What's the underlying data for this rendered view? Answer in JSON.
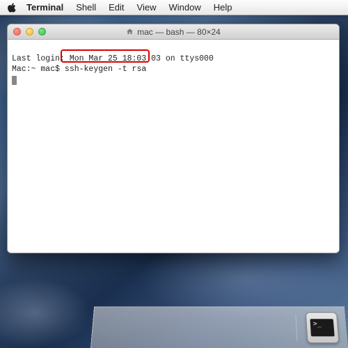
{
  "menubar": {
    "app": "Terminal",
    "items": [
      "Shell",
      "Edit",
      "View",
      "Window",
      "Help"
    ]
  },
  "window": {
    "title": "mac — bash — 80×24"
  },
  "terminal": {
    "line1": "Last login: Mon Mar 25 18:03:03 on ttys000",
    "prompt": "Mac:~ mac$ ",
    "command": "ssh-keygen -t rsa",
    "highlight_command": "ssh-keygen -t rsa"
  },
  "dock": {
    "terminal_prompt": ">_"
  }
}
